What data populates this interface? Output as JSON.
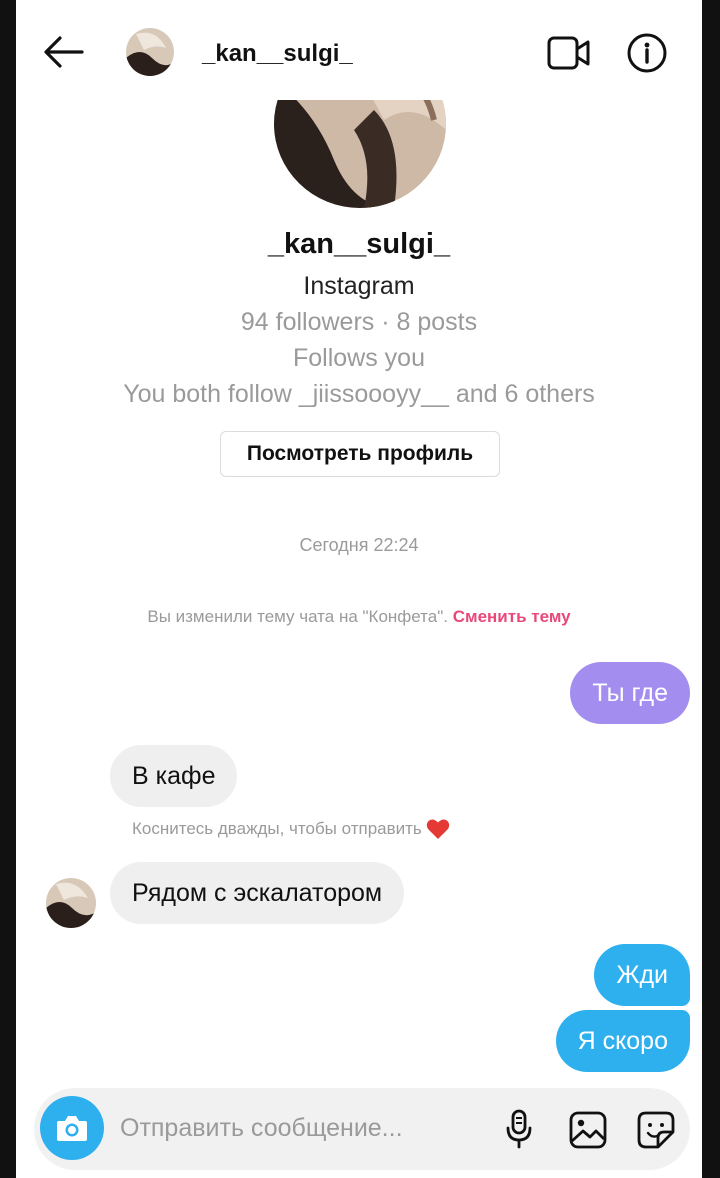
{
  "header": {
    "username": "_kan__sulgi_",
    "back_icon": "arrow-left-icon",
    "video_icon": "video-camera-icon",
    "info_icon": "info-icon"
  },
  "profile": {
    "name": "_kan__sulgi_",
    "platform": "Instagram",
    "stats": "94 followers · 8 posts",
    "follows_you": "Follows you",
    "mutual": "You both follow _jiissoooyy__ and 6 others",
    "view_profile_button": "Посмотреть профиль"
  },
  "chat": {
    "timestamp": "Сегодня 22:24",
    "theme_notice": "Вы изменили тему чата на \"Конфета\".",
    "theme_link": "Сменить тему",
    "double_tap_hint": "Коснитесь дважды, чтобы отправить",
    "messages": [
      {
        "direction": "outgoing",
        "text": "Ты где"
      },
      {
        "direction": "incoming",
        "text": "В кафе"
      },
      {
        "direction": "incoming",
        "text": "Рядом с эскалатором"
      },
      {
        "direction": "outgoing",
        "text": "Жди"
      },
      {
        "direction": "outgoing",
        "text": "Я скоро"
      }
    ]
  },
  "composer": {
    "placeholder": "Отправить сообщение...",
    "camera_icon": "camera-icon",
    "mic_icon": "microphone-icon",
    "gallery_icon": "gallery-icon",
    "sticker_icon": "sticker-icon"
  },
  "colors": {
    "outgoing_purple": "#a38ef0",
    "outgoing_blue": "#2fb0ee",
    "incoming_gray": "#efefef",
    "link_pink": "#e8497a"
  }
}
